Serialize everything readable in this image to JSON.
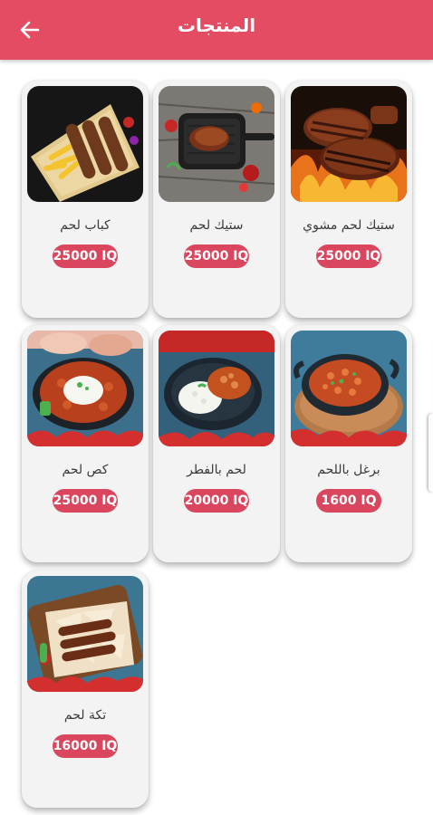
{
  "header": {
    "title": "المنتجات",
    "back_icon": "arrow-left-icon",
    "background": "#e34c63"
  },
  "products": [
    {
      "name": "ستيك لحم مشوي",
      "price": "25000 IQ",
      "image": "grilled-steak-photo"
    },
    {
      "name": "ستيك لحم",
      "price": "25000 IQ",
      "image": "steak-pan-photo"
    },
    {
      "name": "كباب لحم",
      "price": "25000 IQ",
      "image": "kebab-fries-photo"
    },
    {
      "name": "برغل باللحم",
      "price": "1600 IQ",
      "image": "bulgur-meat-photo"
    },
    {
      "name": "لحم بالفطر",
      "price": "20000 IQ",
      "image": "meat-mushroom-photo"
    },
    {
      "name": "كص لحم",
      "price": "25000 IQ",
      "image": "shawarma-rice-photo"
    },
    {
      "name": "تكة لحم",
      "price": "16000 IQ",
      "image": "tikka-bread-photo"
    }
  ],
  "colors": {
    "accent": "#e34c63",
    "price_badge": "#d9465d",
    "card": "#f3f3f3"
  }
}
